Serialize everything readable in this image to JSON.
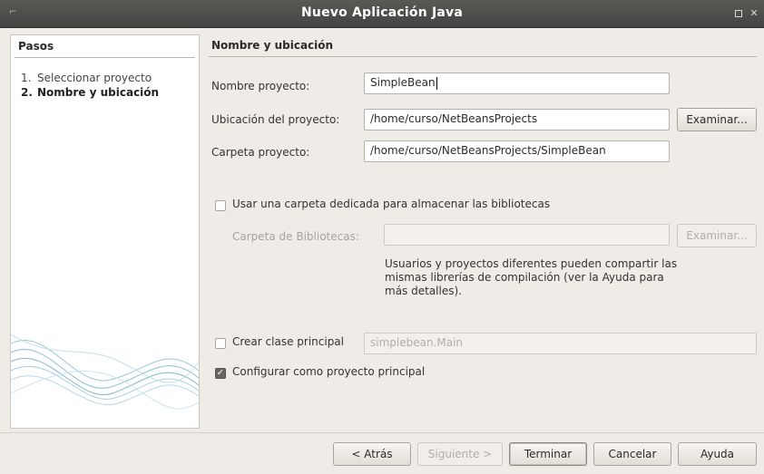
{
  "window": {
    "title": "Nuevo  Aplicación Java"
  },
  "steps": {
    "header": "Pasos",
    "items": [
      {
        "num": "1.",
        "label": "Seleccionar proyecto"
      },
      {
        "num": "2.",
        "label": "Nombre y ubicación"
      }
    ]
  },
  "form": {
    "section_title": "Nombre y ubicación",
    "project_name": {
      "label": "Nombre proyecto:",
      "value": "SimpleBean"
    },
    "location": {
      "label": "Ubicación del proyecto:",
      "value": "/home/curso/NetBeansProjects",
      "browse": "Examinar..."
    },
    "folder": {
      "label": "Carpeta proyecto:",
      "value": "/home/curso/NetBeansProjects/SimpleBean"
    },
    "dedicated_folder": {
      "label": "Usar una carpeta dedicada para almacenar las bibliotecas",
      "checked": false
    },
    "libraries": {
      "label": "Carpeta de Bibliotecas:",
      "value": "",
      "browse": "Examinar..."
    },
    "hint": "Usuarios y proyectos diferentes pueden compartir las mismas librerías de compilación (ver la Ayuda para más detalles).",
    "main_class": {
      "label": "Crear clase principal",
      "value": "simplebean.Main",
      "checked": false
    },
    "set_main": {
      "label": "Configurar como proyecto principal",
      "checked": true
    }
  },
  "buttons": {
    "back": "< Atrás",
    "next": "Siguiente >",
    "finish": "Terminar",
    "cancel": "Cancelar",
    "help": "Ayuda"
  }
}
